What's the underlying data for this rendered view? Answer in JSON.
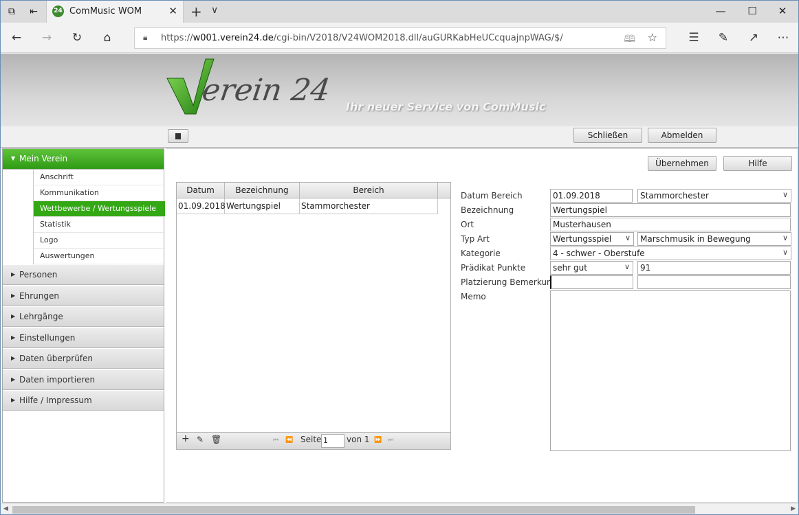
{
  "browser": {
    "tab_title": "ComMusic WOM",
    "favicon_text": "24",
    "url_prefix": "https://",
    "url_domain": "w001.verein24.de",
    "url_path": "/cgi-bin/V2018/V24WOM2018.dll/auGURKabHeUCcquajnpWAG/$/",
    "icons": [
      "tab-manager-icon",
      "set-aside-tabs-icon",
      "close-icon",
      "new-tab-icon",
      "chevron-down-icon",
      "back-icon",
      "forward-icon",
      "refresh-icon",
      "home-icon",
      "lock-icon",
      "reading-view-icon",
      "favorite-star-icon",
      "favorites-list-icon",
      "pen-icon",
      "share-icon",
      "more-icon",
      "minimize-icon",
      "maximize-icon",
      "close-window-icon"
    ]
  },
  "header": {
    "logo_text": "Verein 24",
    "slogan": "Ihr neuer Service von ComMusic",
    "close_label": "Schließen",
    "logout_label": "Abmelden"
  },
  "sidebar": {
    "active_section": "Mein Verein",
    "sub_items": [
      "Anschrift",
      "Kommunikation",
      "Wettbewerbe / Wertungsspiele",
      "Statistik",
      "Logo",
      "Auswertungen"
    ],
    "selected_sub": "Wettbewerbe / Wertungsspiele",
    "sections": [
      "Personen",
      "Ehrungen",
      "Lehrgänge",
      "Einstellungen",
      "Daten überprüfen",
      "Daten importieren",
      "Hilfe / Impressum"
    ]
  },
  "actions": {
    "apply_label": "Übernehmen",
    "help_label": "Hilfe"
  },
  "grid": {
    "columns": [
      "Datum",
      "Bezeichnung",
      "Bereich"
    ],
    "rows": [
      {
        "datum": "01.09.2018",
        "bezeichnung": "Wertungspiel",
        "bereich": "Stammorchester"
      }
    ],
    "pager": {
      "page_label": "Seite",
      "page_value": "1",
      "of_label": "von 1"
    }
  },
  "form": {
    "labels": {
      "datum_bereich": "Datum Bereich",
      "bezeichnung": "Bezeichnung",
      "ort": "Ort",
      "typ_art": "Typ Art",
      "kategorie": "Kategorie",
      "praedikat_punkte": "Prädikat Punkte",
      "platzierung_bemerkung": "Platzierung Bemerkung",
      "memo": "Memo"
    },
    "values": {
      "datum": "01.09.2018",
      "bereich": "Stammorchester",
      "bezeichnung": "Wertungspiel",
      "ort": "Musterhausen",
      "typ": "Wertungsspiel",
      "art": "Marschmusik in Bewegung",
      "kategorie": "4 - schwer - Oberstufe",
      "praedikat": "sehr gut",
      "punkte": "91",
      "platzierung": "",
      "bemerkung": "",
      "memo": ""
    }
  }
}
